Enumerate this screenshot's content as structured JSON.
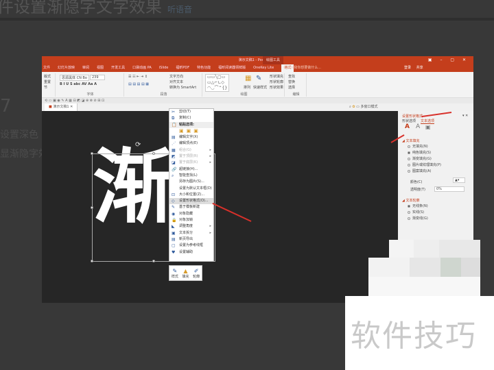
{
  "article": {
    "heading": "件设置渐隐字文字效果",
    "heading_tag": "听语音",
    "step_number": "7",
    "step_text_1": "设置深色",
    "step_text_2": "显渐隐字效"
  },
  "window": {
    "title": "演示文稿1 - PowerPoint",
    "context_tool": "绘图工具",
    "controls": "▣ – ▢ ✕",
    "tabs": [
      "文件",
      "幻灯片放映",
      "审阅",
      "视图",
      "开发工具",
      "口袋动画 PA",
      "iSlide",
      "福昕PDF",
      "特色功能",
      "福昕阅读器领鲜版",
      "OneKey Lite",
      "格式"
    ],
    "tell_me": "♀ 告诉我你想要做什么...",
    "login": "登录",
    "share": "共享"
  },
  "ribbon": {
    "clipboard": [
      "版式",
      "重置",
      "节"
    ],
    "font_name": "思源黑体 CN Bo",
    "font_size": "239",
    "font_group": "字体",
    "paragraph": [
      "文字方向",
      "对齐文本",
      "转换为 SmartArt"
    ],
    "paragraph_group": "段落",
    "drawing_group": "绘图",
    "arrange": "排列",
    "quick_styles": "快速样式",
    "shape_fill": "形状填充",
    "shape_outline": "形状轮廓",
    "shape_effects": "形状效果",
    "find": "查找",
    "replace": "替换",
    "select": "选择",
    "editing_group": "编辑"
  },
  "doc_tab": "演示文稿1",
  "view_options": "多窗口模式",
  "slide": {
    "text": "渐"
  },
  "context_menu": {
    "items": [
      {
        "label": "剪切(T)",
        "icon": "✂",
        "state": "normal"
      },
      {
        "label": "复制(C)",
        "icon": "⧉",
        "state": "normal"
      },
      {
        "label": "粘贴选项:",
        "icon": "📋",
        "state": "header"
      },
      {
        "label": "",
        "icon": "",
        "state": "paste-icons"
      },
      {
        "label": "编辑文字(X)",
        "icon": "▤",
        "state": "normal"
      },
      {
        "label": "编辑顶点(E)",
        "icon": "⋰",
        "state": "normal"
      },
      {
        "label": "组合(G)",
        "icon": "▦",
        "state": "disabled",
        "sub": true
      },
      {
        "label": "置于顶层(R)",
        "icon": "◩",
        "state": "disabled",
        "sub": true
      },
      {
        "label": "置于底层(K)",
        "icon": "◪",
        "state": "disabled",
        "sub": true
      },
      {
        "label": "超链接(H)...",
        "icon": "🔗",
        "state": "normal"
      },
      {
        "label": "智能查找(L)",
        "icon": "⌕",
        "state": "normal"
      },
      {
        "label": "另存为图片(S)...",
        "icon": "",
        "state": "normal"
      },
      {
        "label": "设置为默认文本框(D)",
        "icon": "",
        "state": "normal"
      },
      {
        "label": "大小和位置(Z)...",
        "icon": "⊡",
        "state": "normal"
      },
      {
        "label": "设置形状格式(O)...",
        "icon": "◇",
        "state": "highlighted"
      },
      {
        "label": "基于模板新建",
        "icon": "✎",
        "state": "normal"
      },
      {
        "label": "对象隐藏",
        "icon": "◉",
        "state": "normal"
      },
      {
        "label": "对象加锁",
        "icon": "🔒",
        "state": "normal"
      },
      {
        "label": "调整角度",
        "icon": "◣",
        "state": "normal",
        "sub": true
      },
      {
        "label": "文本拆分",
        "icon": "▣",
        "state": "normal",
        "sub": true
      },
      {
        "label": "新页导出",
        "icon": "▤",
        "state": "normal"
      },
      {
        "label": "设置为参考线框",
        "icon": "▢",
        "state": "normal"
      },
      {
        "label": "设置辅助",
        "icon": "♥",
        "state": "normal"
      }
    ]
  },
  "mini_toolbar": [
    "样式",
    "填充",
    "轮廓"
  ],
  "format_pane": {
    "title": "设置形状格式",
    "tab_shape": "形状选项",
    "tab_text": "文本选项",
    "fill_section": "文本填充",
    "fill_options": [
      {
        "label": "无填充(N)",
        "selected": false
      },
      {
        "label": "纯色填充(S)",
        "selected": true
      },
      {
        "label": "渐变填充(G)",
        "selected": false
      },
      {
        "label": "图片或纹理填充(P)",
        "selected": false
      },
      {
        "label": "图案填充(A)",
        "selected": false
      }
    ],
    "color_label": "颜色(C)",
    "transparency_label": "透明度(T)",
    "transparency_value": "0%",
    "outline_section": "文本轮廓",
    "outline_options": [
      {
        "label": "无线条(N)",
        "selected": true
      },
      {
        "label": "实线(S)",
        "selected": false
      },
      {
        "label": "渐变线(G)",
        "selected": false
      }
    ]
  },
  "watermark": "软件技巧",
  "colors": {
    "accent": "#c43e1c",
    "arrow": "#d8302a",
    "background": "#383838"
  }
}
